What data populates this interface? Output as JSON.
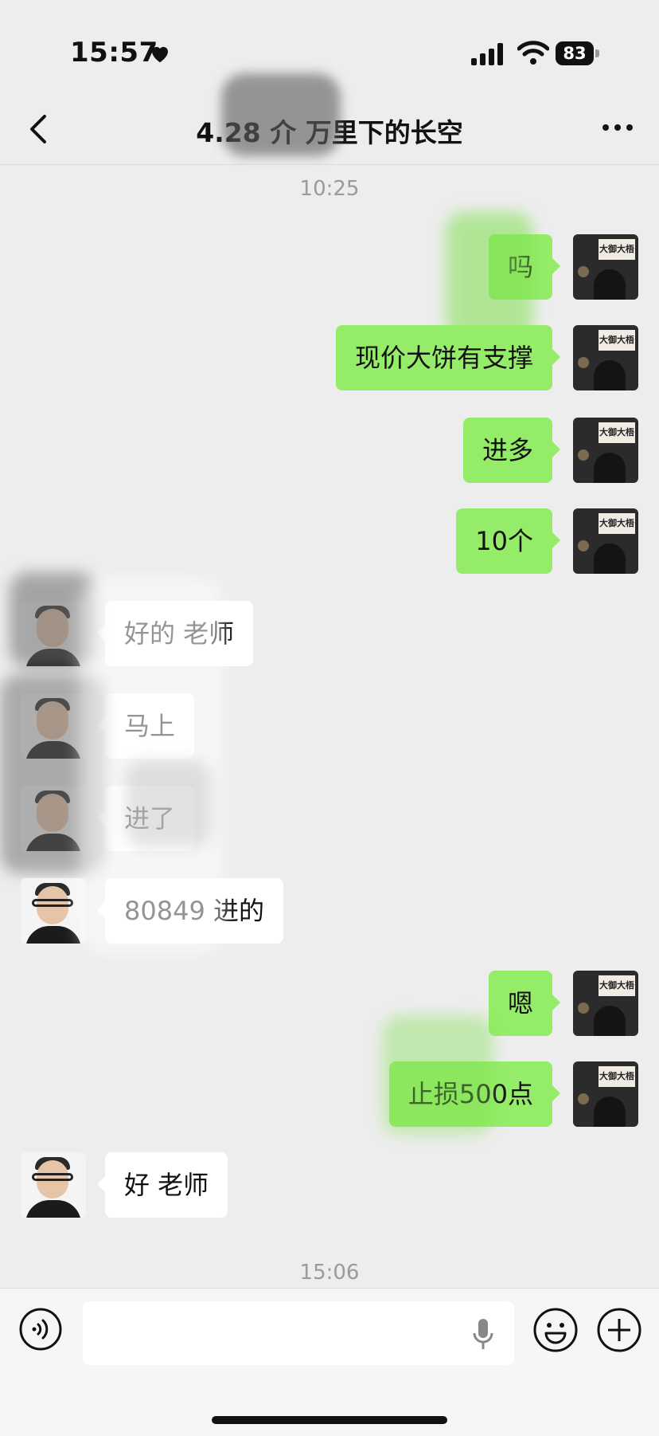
{
  "status_bar": {
    "time": "15:57",
    "battery": "83"
  },
  "nav": {
    "title": "4.28 介 万里下的长空"
  },
  "timestamps": [
    "10:25",
    "15:06"
  ],
  "messages": [
    {
      "side": "out",
      "text": "吗"
    },
    {
      "side": "out",
      "text": "现价大饼有支撑"
    },
    {
      "side": "out",
      "text": "进多"
    },
    {
      "side": "out",
      "text": "10个"
    },
    {
      "side": "in",
      "text": "好的 老师"
    },
    {
      "side": "in",
      "text": "马上"
    },
    {
      "side": "in",
      "text": "进了"
    },
    {
      "side": "in",
      "text": "80849 进的"
    },
    {
      "side": "out",
      "text": "嗯"
    },
    {
      "side": "out",
      "text": "止损500点"
    },
    {
      "side": "in",
      "text": "好 老师"
    }
  ],
  "avatar_sign": "大御大梧",
  "icons": {
    "back": "chevron-left-icon",
    "more": "ellipsis-icon",
    "voice": "voice-icon",
    "mic": "microphone-icon",
    "emoji": "smiley-icon",
    "plus": "plus-icon"
  },
  "colors": {
    "outgoing_bubble": "#95ec69",
    "incoming_bubble": "#ffffff",
    "background": "#ededed"
  }
}
